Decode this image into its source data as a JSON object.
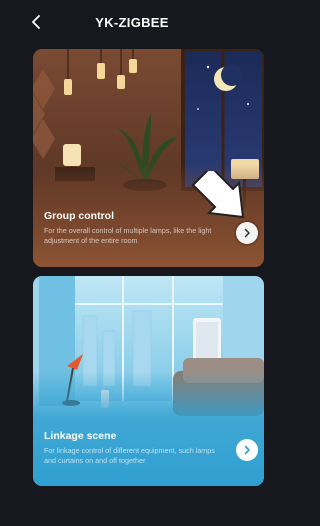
{
  "header": {
    "title": "YK-ZIGBEE"
  },
  "cards": [
    {
      "title": "Group control",
      "description": "For the overall control of multiple lamps, like the light adjustment of the entire room"
    },
    {
      "title": "Linkage scene",
      "description": "For linkage control of different equipment, such lamps and curtains on and off together"
    }
  ],
  "colors": {
    "background": "#16181d",
    "scene_accent": "#2f9fd0"
  },
  "icons": [
    "back-arrow-icon",
    "chevron-right-icon",
    "pointer-arrow-icon"
  ]
}
